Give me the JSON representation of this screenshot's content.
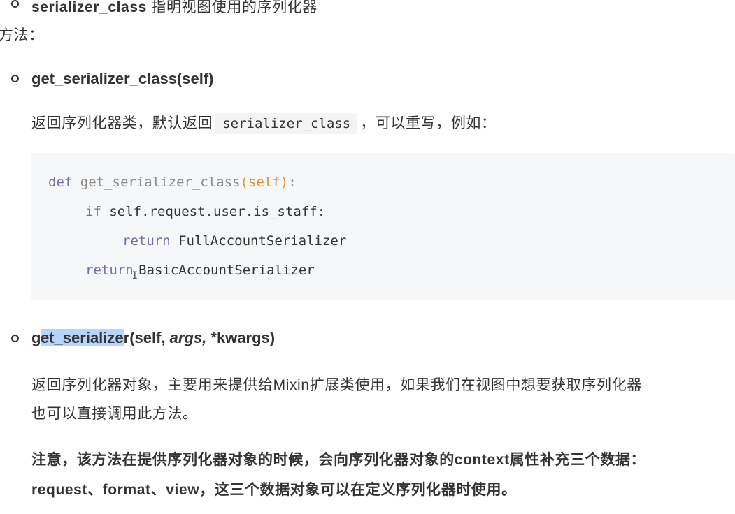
{
  "top_item": {
    "bold": "serializer_class",
    "text": " 指明视图使用的序列化器"
  },
  "methods_label": "方法：",
  "method1": {
    "heading": "get_serializer_class(self)",
    "desc_before": "返回序列化器类，默认返回",
    "desc_code": "serializer_class",
    "desc_after": "，可以重写，例如："
  },
  "code": {
    "line1": {
      "kw": "def",
      "fn": " get_serializer_class",
      "arg": "(self)",
      "end": ":"
    },
    "line2": {
      "kw": "if",
      "rest": " self.request.user.is_staff:"
    },
    "line3": {
      "kw": "return",
      "rest": " FullAccountSerializer"
    },
    "line4": {
      "kw": "return",
      "cursor": "I",
      "rest": "BasicAccountSerializer"
    }
  },
  "method2": {
    "heading_highlight": "get_serialize",
    "heading_rest": "r(self, ",
    "heading_args": "args,",
    "heading_kwargs": " *kwargs)",
    "desc_line1": "返回序列化器对象，主要用来提供给Mixin扩展类使用，如果我们在视图中想要获取序列化器",
    "desc_line2": "也可以直接调用此方法。",
    "note_line1": "注意，该方法在提供序列化器对象的时候，会向序列化器对象的context属性补充三个数据：",
    "note_line2": "request、format、view，这三个数据对象可以在定义序列化器时使用。"
  }
}
